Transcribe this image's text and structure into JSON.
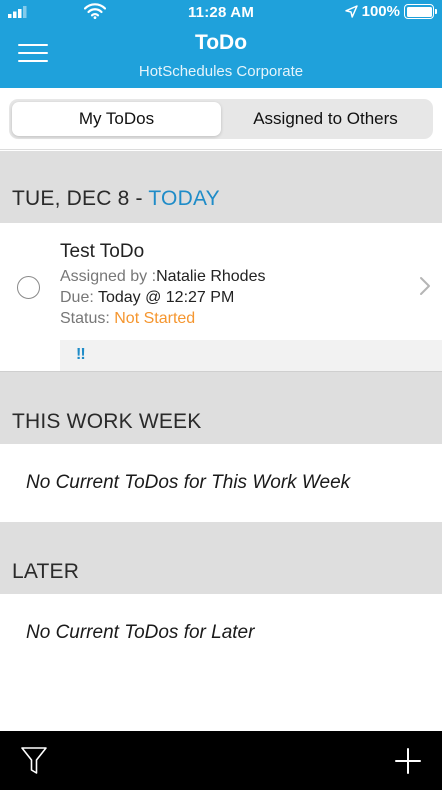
{
  "status_bar": {
    "time": "11:28 AM",
    "battery": "100%",
    "icons": [
      "signal-icon",
      "wifi-icon",
      "location-arrow-icon",
      "battery-icon"
    ]
  },
  "header": {
    "title": "ToDo",
    "subtitle": "HotSchedules Corporate",
    "background": "#1FA1DB"
  },
  "tabs": [
    {
      "label": "My ToDos",
      "active": true
    },
    {
      "label": "Assigned to Others",
      "active": false
    }
  ],
  "sections": {
    "today": {
      "date_label": "TUE, DEC 8 - ",
      "today_label": "TODAY",
      "todos": [
        {
          "title": "Test ToDo",
          "assigned_by_label": "Assigned by :",
          "assigned_by": "Natalie Rhodes",
          "due_label": "Due: ",
          "due": "Today @ 12:27 PM",
          "status_label": "Status: ",
          "status": "Not Started",
          "priority": "!!"
        }
      ]
    },
    "work_week": {
      "label": "THIS WORK WEEK",
      "empty_message": "No Current ToDos for This Work Week"
    },
    "later": {
      "label": "LATER",
      "empty_message": "No Current ToDos for Later"
    }
  },
  "colors": {
    "accent": "#1FA1DB",
    "today": "#1F8CC8",
    "status_not_started": "#F5962F",
    "section_bg": "#DEDEDE",
    "bottom_bar": "#000000"
  },
  "bottom_bar": {
    "icons": [
      "filter-icon",
      "add-icon"
    ]
  }
}
